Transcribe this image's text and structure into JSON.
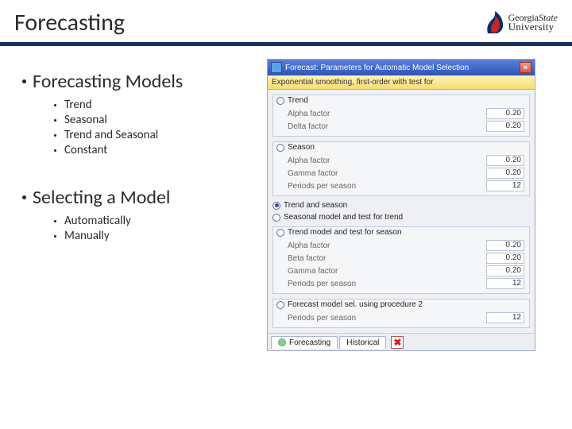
{
  "header": {
    "title": "Forecasting",
    "logo": {
      "line1": "GeorgiaState",
      "line2": "University"
    }
  },
  "left": {
    "h1": "Forecasting Models",
    "h1_items": [
      "Trend",
      "Seasonal",
      "Trend and Seasonal",
      "Constant"
    ],
    "h2": "Selecting a Model",
    "h2_items": [
      "Automatically",
      "Manually"
    ]
  },
  "dialog": {
    "title": "Forecast: Parameters for Automatic Model Selection",
    "close": "×",
    "yellow": "Exponential smoothing, first-order with test for",
    "sections": [
      {
        "name": "Trend",
        "selected": false,
        "rows": [
          {
            "label": "Alpha factor",
            "value": "0.20"
          },
          {
            "label": "Delta factor",
            "value": "0.20"
          }
        ]
      },
      {
        "name": "Season",
        "selected": false,
        "rows": [
          {
            "label": "Alpha factor",
            "value": "0.20"
          },
          {
            "label": "Gamma factor",
            "value": "0.20"
          },
          {
            "label": "Periods per season",
            "value": "12"
          }
        ]
      }
    ],
    "lines": [
      {
        "name": "Trend and season",
        "selected": true
      },
      {
        "name": "Seasonal model and test for trend",
        "selected": false
      }
    ],
    "section2": {
      "name": "Trend model and test for season",
      "selected": false,
      "rows": [
        {
          "label": "Alpha factor",
          "value": "0.20"
        },
        {
          "label": "Beta factor",
          "value": "0.20"
        },
        {
          "label": "Gamma factor",
          "value": "0.20"
        },
        {
          "label": "Periods per season",
          "value": "12"
        }
      ]
    },
    "section3": {
      "name": "Forecast model sel. using procedure 2",
      "selected": false,
      "rows": [
        {
          "label": "Periods per season",
          "value": "12"
        }
      ]
    },
    "footer": {
      "tab1": "Forecasting",
      "tab2": "Historical",
      "close": "✖"
    }
  }
}
